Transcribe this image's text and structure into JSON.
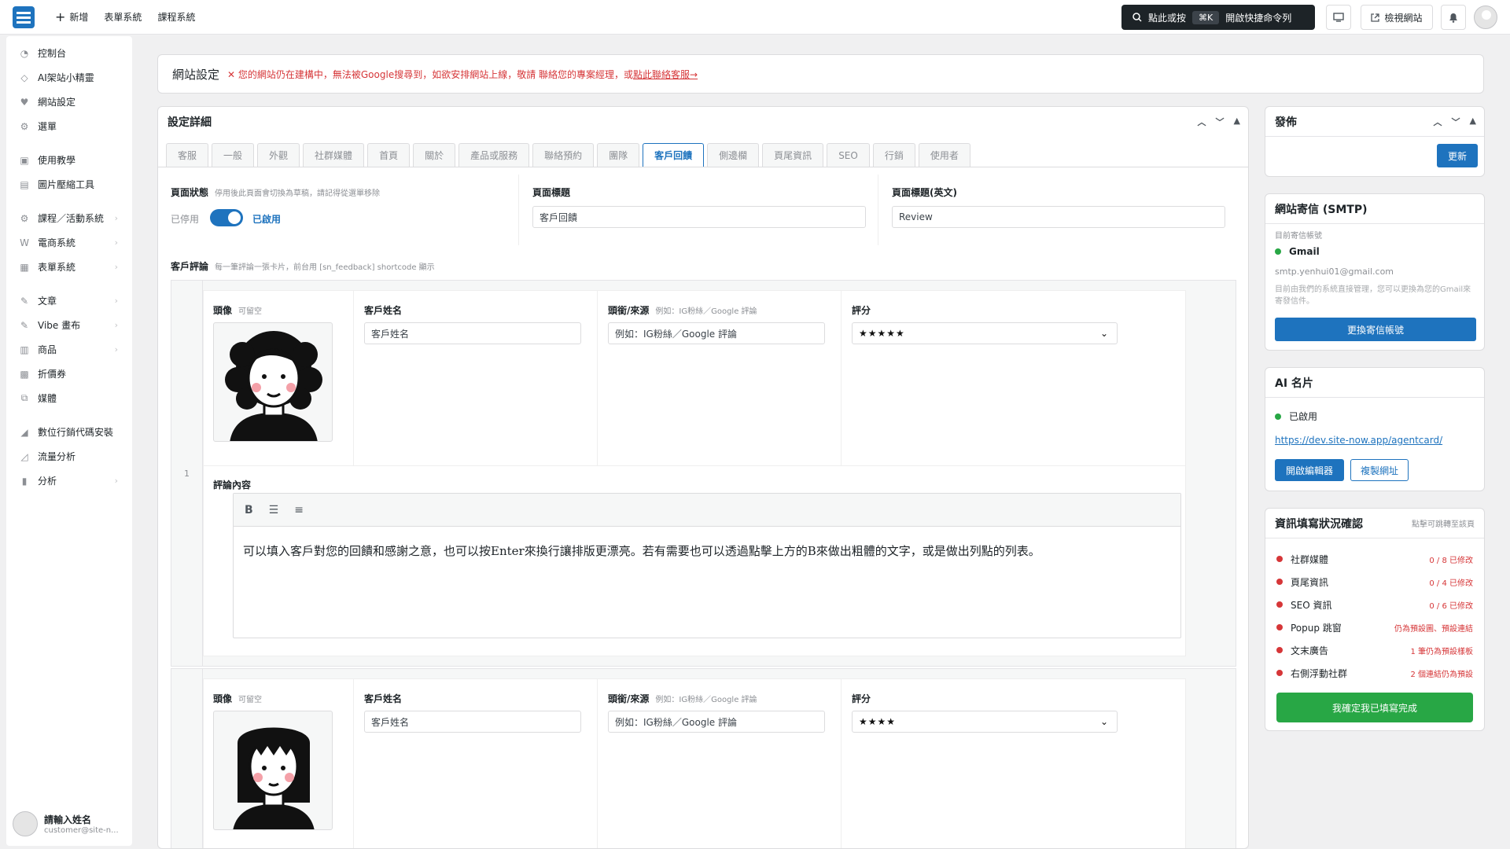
{
  "topnav": {
    "add": "新增",
    "forms": "表單系統",
    "courses": "課程系統"
  },
  "command": {
    "label": "點此或按",
    "key": "⌘K",
    "action": "開啟快捷命令列"
  },
  "view_site": "檢視網站",
  "sidebar": {
    "items": [
      {
        "label": "控制台",
        "icon": "dashboard-icon"
      },
      {
        "label": "AI架站小精靈",
        "icon": "ai-icon"
      },
      {
        "label": "網站設定",
        "icon": "heart-icon"
      },
      {
        "label": "選單",
        "icon": "gear-icon"
      },
      {
        "label": "使用教學",
        "icon": "book-icon"
      },
      {
        "label": "圖片壓縮工具",
        "icon": "image-icon"
      },
      {
        "label": "課程／活動系統",
        "icon": "gear-icon"
      },
      {
        "label": "電商系統",
        "icon": "shop-icon"
      },
      {
        "label": "表單系統",
        "icon": "form-icon"
      },
      {
        "label": "文章",
        "icon": "pin-icon"
      },
      {
        "label": "Vibe 畫布",
        "icon": "pin-icon"
      },
      {
        "label": "商品",
        "icon": "box-icon"
      },
      {
        "label": "折價券",
        "icon": "coupon-icon"
      },
      {
        "label": "媒體",
        "icon": "media-icon"
      },
      {
        "label": "數位行銷代碼安裝",
        "icon": "chart-icon"
      },
      {
        "label": "流量分析",
        "icon": "chart-icon"
      },
      {
        "label": "分析",
        "icon": "bar-icon"
      }
    ],
    "user_name": "請輸入姓名",
    "user_email": "customer@site-n..."
  },
  "banner": {
    "title": "網站設定",
    "warning": "✕ 您的網站仍在建構中，無法被Google搜尋到，如欲安排網站上線，敬請 聯絡您的專案經理，或",
    "link": "點此聯絡客服→"
  },
  "main": {
    "title": "設定詳細",
    "tabs": [
      "客服",
      "一般",
      "外觀",
      "社群媒體",
      "首頁",
      "關於",
      "產品或服務",
      "聯絡預約",
      "團隊",
      "客戶回饋",
      "側邊欄",
      "頁尾資訊",
      "SEO",
      "行銷",
      "使用者"
    ],
    "page_status_label": "頁面狀態",
    "page_status_hint": "停用後此頁面會切換為草稿，請記得從選單移除",
    "disabled": "已停用",
    "enabled": "已啟用",
    "page_title_label": "頁面標題",
    "page_title_value": "客戶回饋",
    "page_title_en_label": "頁面標題(英文)",
    "page_title_en_value": "Review",
    "reviews_label": "客戶評論",
    "reviews_hint": "每一筆評論一張卡片，前台用 [sn_feedback] shortcode 顯示",
    "avatar_label": "頭像",
    "avatar_hint": "可留空",
    "name_label": "客戶姓名",
    "name_placeholder": "客戶姓名",
    "source_label": "頭銜/來源",
    "source_hint": "例如：IG粉絲／Google 評論",
    "source_placeholder": "例如：IG粉絲／Google 評論",
    "rating_label": "評分",
    "row_number": "1",
    "content_label": "評論內容",
    "content_text": "可以填入客戶對您的回饋和感謝之意，也可以按Enter來換行讓排版更漂亮。若有需要也可以透過點擊上方的B來做出粗體的文字，或是做出列點的列表。",
    "review1_rating": "★★★★★",
    "review2_rating": "★★★★"
  },
  "publish": {
    "title": "發佈",
    "update": "更新"
  },
  "smtp": {
    "title": "網站寄信 (SMTP)",
    "current_label": "目前寄信帳號",
    "provider": "Gmail",
    "email": "smtp.yenhui01@gmail.com",
    "note": "目前由我們的系統直接管理，您可以更換為您的Gmail來寄發信件。",
    "button": "更換寄信帳號"
  },
  "ai_card": {
    "title": "AI 名片",
    "status": "已啟用",
    "url": "https://dev.site-now.app/agentcard/",
    "open": "開啟編輯器",
    "copy": "複製網址"
  },
  "checklist": {
    "title": "資訊填寫狀況確認",
    "hint": "點擊可跳轉至該頁",
    "items": [
      {
        "label": "社群媒體",
        "status": "0 / 8 已修改"
      },
      {
        "label": "頁尾資訊",
        "status": "0 / 4 已修改"
      },
      {
        "label": "SEO 資訊",
        "status": "0 / 6 已修改"
      },
      {
        "label": "Popup 跳窗",
        "status": "仍為預設圖、預設連結"
      },
      {
        "label": "文末廣告",
        "status": "1 筆仍為預設樣板"
      },
      {
        "label": "右側浮動社群",
        "status": "2 個連結仍為預設"
      }
    ],
    "confirm": "我確定我已填寫完成"
  },
  "colors": {
    "accent": "#1e73be",
    "danger": "#d63638",
    "success": "#28a745"
  }
}
